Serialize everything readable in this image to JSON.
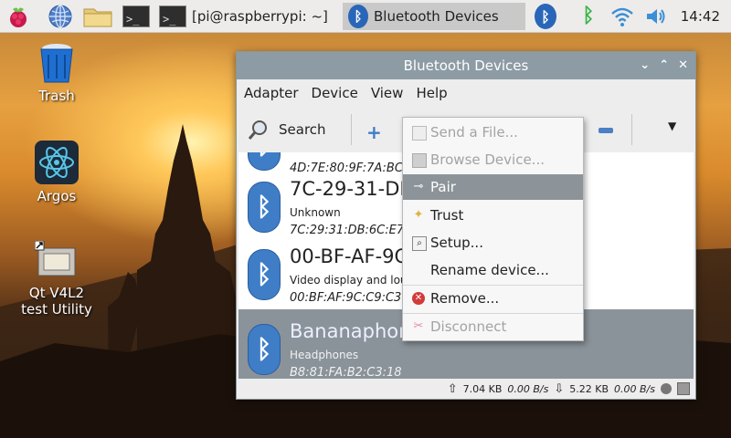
{
  "taskbar": {
    "terminal_prompt": ">_",
    "terminal_title": "[pi@raspberrypi: ~]",
    "active_window": "Bluetooth Devices",
    "clock": "14:42"
  },
  "desktop": {
    "icons": [
      {
        "label": "Trash"
      },
      {
        "label": "Argos"
      },
      {
        "label": "Qt V4L2 test Utility"
      }
    ]
  },
  "window": {
    "title": "Bluetooth Devices",
    "controls": [
      "⌄",
      "⌃",
      "✕"
    ],
    "menu": [
      "Adapter",
      "Device",
      "View",
      "Help"
    ],
    "toolbar": {
      "search_label": "Search"
    },
    "devices": [
      {
        "name": "",
        "type": "",
        "address": "4D:7E:80:9F:7A:BC"
      },
      {
        "name": "7C-29-31-DB",
        "type": "Unknown",
        "address": "7C:29:31:DB:6C:E7"
      },
      {
        "name": "00-BF-AF-9C",
        "type": "Video display and loud",
        "address": "00:BF:AF:9C:C9:C3"
      },
      {
        "name": "Bananaphone",
        "type": "Headphones",
        "address": "B8:81:FA:B2:C3:18",
        "selected": true
      }
    ],
    "status": {
      "upload_total": "7.04 KB",
      "upload_rate": "0.00 B/s",
      "download_total": "5.22 KB",
      "download_rate": "0.00 B/s"
    }
  },
  "context_menu": {
    "items": [
      {
        "label": "Send a File...",
        "icon": "send-file-icon",
        "enabled": false
      },
      {
        "label": "Browse Device...",
        "icon": "browse-icon",
        "enabled": false
      },
      {
        "label": "Pair",
        "icon": "key-icon",
        "enabled": true,
        "highlighted": true
      },
      {
        "label": "Trust",
        "icon": "star-icon",
        "enabled": true
      },
      {
        "label": "Setup...",
        "icon": "setup-icon",
        "enabled": true
      },
      {
        "label": "Rename device...",
        "icon": "",
        "enabled": true
      },
      {
        "label": "Remove...",
        "icon": "remove-icon",
        "enabled": true
      },
      {
        "label": "Disconnect",
        "icon": "disconnect-icon",
        "enabled": false
      }
    ]
  },
  "colors": {
    "bluetooth_blue": "#3f7dc7",
    "selection": "#8a939a",
    "titlebar": "#8d9ba4"
  }
}
